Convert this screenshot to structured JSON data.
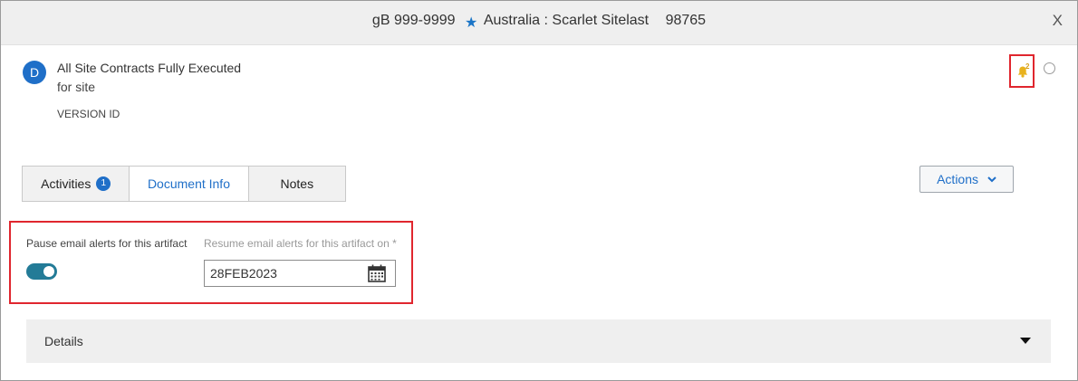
{
  "header": {
    "code": "gB 999-9999",
    "star_icon": "star-icon",
    "location": "Australia : Scarlet Sitelast",
    "number": "98765",
    "close_label": "X"
  },
  "document": {
    "avatar_letter": "D",
    "title": "All Site Contracts Fully Executed",
    "subtitle": "for site",
    "version_label": "VERSION ID"
  },
  "notifications": {
    "icon": "bell-icon",
    "count": "2",
    "accent": "#e8b21e",
    "highlight": "#e0262e"
  },
  "tabs": [
    {
      "label": "Activities",
      "badge": "1"
    },
    {
      "label": "Document Info"
    },
    {
      "label": "Notes"
    }
  ],
  "actions": {
    "label": "Actions"
  },
  "alerts": {
    "pause_label": "Pause email alerts for this artifact",
    "pause_enabled": true,
    "resume_label": "Resume email alerts for this artifact on *",
    "resume_date": "28FEB2023"
  },
  "details": {
    "label": "Details"
  },
  "colors": {
    "accent": "#1f6fc8",
    "toggle": "#237b97",
    "panel": "#efefef"
  }
}
